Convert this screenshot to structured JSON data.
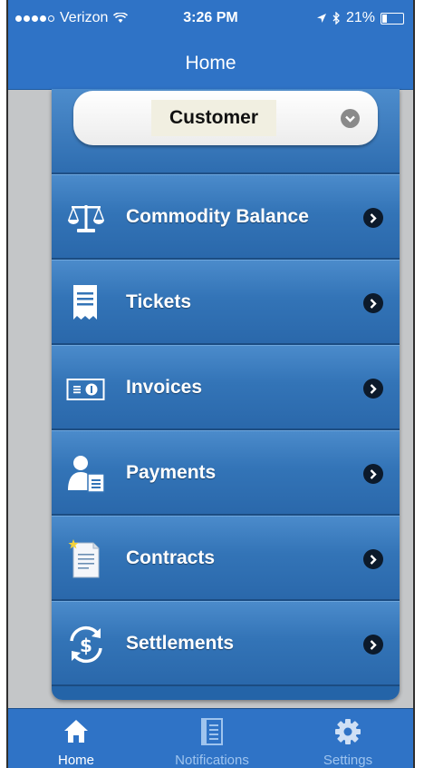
{
  "status_bar": {
    "carrier": "Verizon",
    "time": "3:26 PM",
    "battery": "21%"
  },
  "nav": {
    "title": "Home"
  },
  "customer_select": {
    "label": "Customer"
  },
  "menu": [
    {
      "label": "Commodity Balance",
      "icon": "scale-icon"
    },
    {
      "label": "Tickets",
      "icon": "receipt-icon"
    },
    {
      "label": "Invoices",
      "icon": "invoice-icon"
    },
    {
      "label": "Payments",
      "icon": "payment-user-icon"
    },
    {
      "label": "Contracts",
      "icon": "contract-icon"
    },
    {
      "label": "Settlements",
      "icon": "settlement-icon"
    }
  ],
  "tabs": [
    {
      "label": "Home",
      "icon": "home-icon",
      "active": true
    },
    {
      "label": "Notifications",
      "icon": "notifications-icon",
      "active": false
    },
    {
      "label": "Settings",
      "icon": "gear-icon",
      "active": false
    }
  ],
  "colors": {
    "brand_blue": "#2f73c6",
    "panel_blue": "#3374b7",
    "background": "#c4c6c8"
  }
}
